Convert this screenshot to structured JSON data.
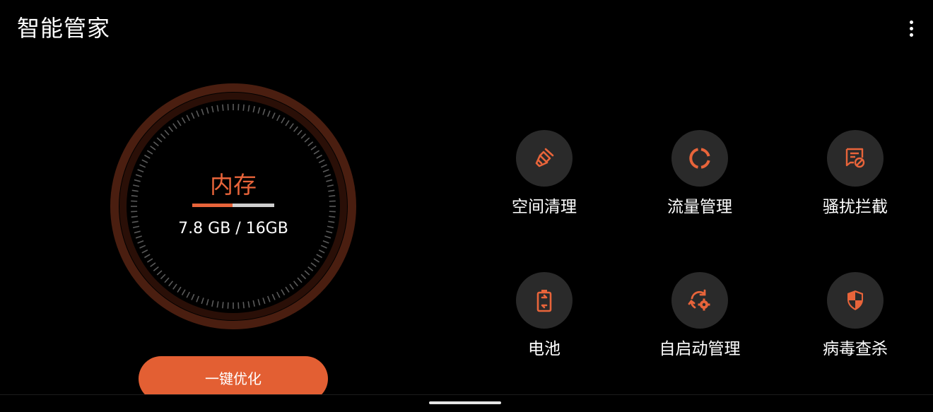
{
  "header": {
    "title": "智能管家",
    "more_icon": "more-vert-icon"
  },
  "gauge": {
    "label": "内存",
    "used": "7.8 GB",
    "total": "16GB",
    "value_text": "7.8 GB / 16GB",
    "used_fraction": 0.49,
    "accent_color": "#e8643a"
  },
  "optimize_button": {
    "label": "一键优化"
  },
  "features": [
    {
      "label": "空间清理",
      "icon": "broom-icon"
    },
    {
      "label": "流量管理",
      "icon": "data-usage-icon"
    },
    {
      "label": "骚扰拦截",
      "icon": "block-message-icon"
    },
    {
      "label": "电池",
      "icon": "battery-icon"
    },
    {
      "label": "自启动管理",
      "icon": "autostart-gear-icon"
    },
    {
      "label": "病毒查杀",
      "icon": "shield-icon"
    }
  ],
  "colors": {
    "accent": "#e35f33",
    "icon_bg": "#2a2a2a",
    "background": "#000000"
  }
}
